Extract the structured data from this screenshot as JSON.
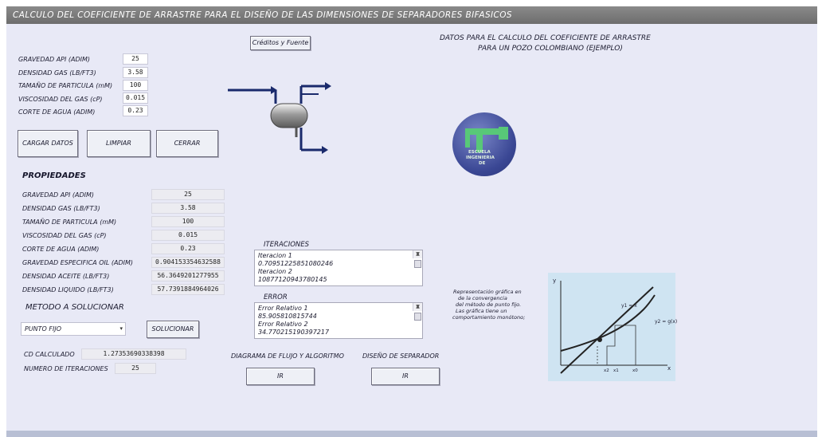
{
  "window": {
    "title": "CALCULO DEL COEFICIENTE DE ARRASTRE PARA EL DISEÑO DE LAS DIMENSIONES DE SEPARADORES BIFASICOS"
  },
  "credits_button": "Créditos y Fuente",
  "example_title": {
    "line1": "DATOS PARA EL CALCULO DEL COEFICIENTE DE ARRASTRE",
    "line2": "PARA UN POZO COLOMBIANO (EJEMPLO)"
  },
  "inputs": [
    {
      "label": "GRAVEDAD API (ADIM)",
      "value": "25"
    },
    {
      "label": "DENSIDAD GAS (LB/FT3)",
      "value": "3.58"
    },
    {
      "label": "TAMAÑO DE PARTICULA (mM)",
      "value": "100"
    },
    {
      "label": "VISCOSIDAD DEL GAS (cP)",
      "value": "0.015"
    },
    {
      "label": "CORTE DE AGUA (ADIM)",
      "value": "0.23"
    }
  ],
  "buttons": {
    "load": "CARGAR DATOS",
    "clear": "LIMPIAR",
    "close": "CERRAR",
    "solve": "SOLUCIONAR",
    "flow_go": "IR",
    "sep_go": "IR"
  },
  "properties": {
    "heading": "PROPIEDADES",
    "rows": [
      {
        "label": "GRAVEDAD API (ADIM)",
        "value": "25"
      },
      {
        "label": "DENSIDAD GAS (LB/FT3)",
        "value": "3.58"
      },
      {
        "label": "TAMAÑO DE PARTICULA (mM)",
        "value": "100"
      },
      {
        "label": "VISCOSIDAD DEL GAS (cP)",
        "value": "0.015"
      },
      {
        "label": "CORTE DE AGUA (ADIM)",
        "value": "0.23"
      },
      {
        "label": "GRAVEDAD ESPECIFICA OIL (ADIM)",
        "value": "0.904153354632588"
      },
      {
        "label": "DENSIDAD ACEITE (LB/FT3)",
        "value": "56.3649201277955"
      },
      {
        "label": "DENSIDAD LIQUIDO  (LB/FT3)",
        "value": "57.7391884964026"
      }
    ]
  },
  "method": {
    "heading": "METODO A SOLUCIONAR",
    "selected": "PUNTO FIJO"
  },
  "results": {
    "cd_label": "CD CALCULADO",
    "cd_value": "1.27353690338398",
    "iter_label": "NUMERO DE ITERACIONES",
    "iter_value": "25"
  },
  "iterations": {
    "label": "ITERACIONES",
    "items": [
      "Iteracion  1",
      "0.709512258510802​46",
      "Iteracion  2",
      "10877120943780145"
    ]
  },
  "error": {
    "label": "ERROR",
    "items": [
      "Error Relativo  1",
      "85.905810815744",
      "Error Relativo  2",
      "34.7702151903​97217"
    ]
  },
  "flow_label": "DIAGRAMA DE FLUJO Y ALGORITMO",
  "sep_label": "DISEÑO DE SEPARADOR",
  "logo": {
    "line1": "ESCUELA",
    "line2": "INGENIERIA",
    "line3": "DE"
  },
  "note": [
    "Representación gráfica en",
    "de la convergencia",
    "del método de punto fijo.",
    "Las gráfica tiene un",
    "comportamiento monótono;"
  ],
  "graph": {
    "y_axis": "y",
    "x_axis": "x",
    "line_label": "y1 = x",
    "curve_label": "y2 = g(x)",
    "ticks": [
      "x2",
      "x1",
      "x0"
    ]
  },
  "colors": {
    "client_bg": "#e8e9f6",
    "titlebar": "#7a7a7a",
    "navy": "#1a2a6c"
  }
}
